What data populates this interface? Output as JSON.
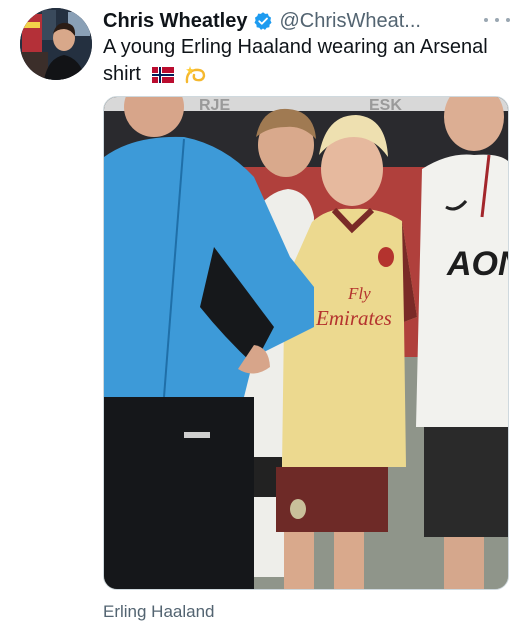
{
  "tweet": {
    "author_name": "Chris Wheatley",
    "author_handle": "@ChrisWheat...",
    "text": "A young Erling Haaland wearing an Arsenal shirt",
    "flag_icon": "norway-flag-emoji",
    "dizzy_icon": "dizzy-emoji",
    "media_signs": [
      "RJE",
      "ESK"
    ],
    "shirt_text": {
      "arsenal_line1": "Fly",
      "arsenal_line2": "Emirates",
      "united_sponsor": "AON"
    },
    "media_caption": "Erling Haaland"
  },
  "colors": {
    "verified": "#1d9bf0",
    "text": "#0f1419",
    "secondary": "#536471",
    "arsenal_yellow": "#ecd98f",
    "arsenal_maroon": "#7a2a27",
    "coach_blue": "#3d9ad8"
  }
}
